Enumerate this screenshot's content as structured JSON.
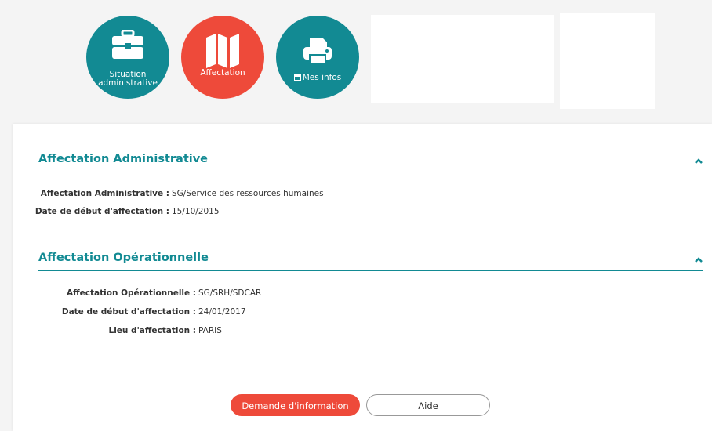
{
  "nav": {
    "situation": {
      "label_line1": "Situation",
      "label_line2": "administrative",
      "icon": "briefcase-icon"
    },
    "affectation": {
      "label": "Affectation",
      "icon": "map-icon"
    },
    "mes_infos": {
      "label": "Mes infos",
      "icon": "printer-icon"
    }
  },
  "sections": [
    {
      "title": "Affectation Administrative",
      "rows": [
        {
          "label": "Affectation Administrative :",
          "value": "SG/Service des ressources humaines"
        },
        {
          "label": "Date de début d'affectation :",
          "value": "15/10/2015"
        }
      ]
    },
    {
      "title": "Affectation Opérationnelle",
      "rows": [
        {
          "label": "Affectation Opérationnelle :",
          "value": "SG/SRH/SDCAR"
        },
        {
          "label": "Date de début d'affectation :",
          "value": "24/01/2017"
        },
        {
          "label": "Lieu d'affectation :",
          "value": "PARIS"
        }
      ]
    }
  ],
  "buttons": {
    "demande": "Demande d'information",
    "aide": "Aide"
  },
  "colors": {
    "teal": "#128a93",
    "red": "#ee4a3a"
  }
}
